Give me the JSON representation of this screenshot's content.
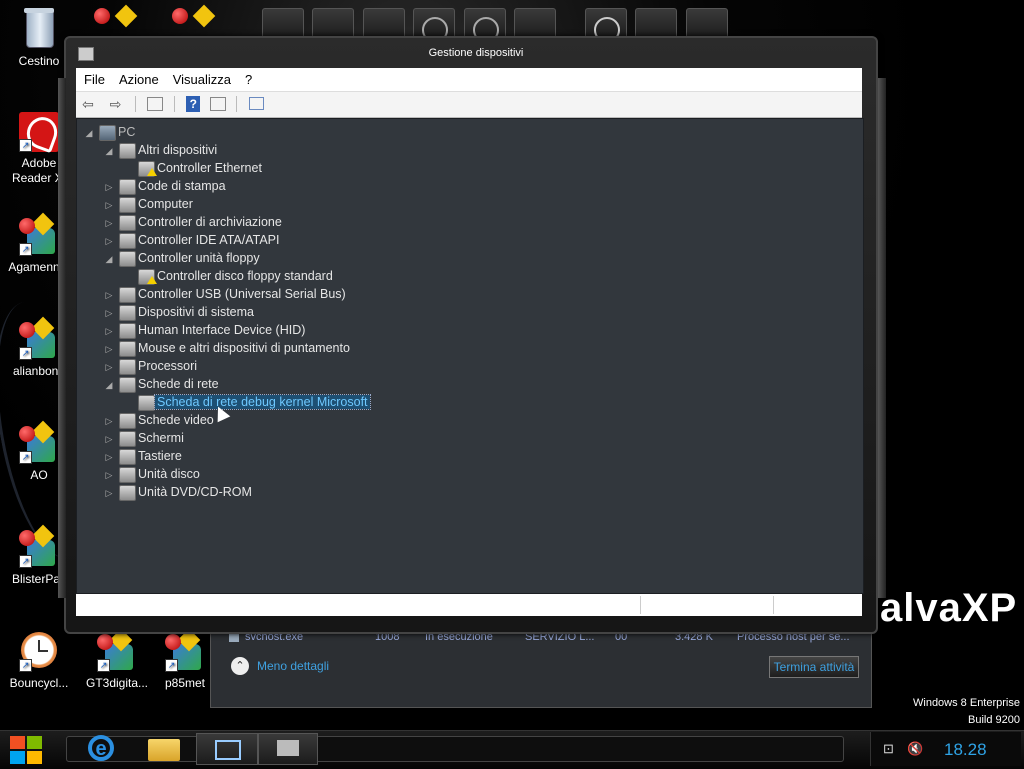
{
  "desktop": {
    "icons": [
      {
        "label": "Cestino"
      },
      {
        "label": "Adobe Reader XI"
      },
      {
        "label": "Agamenn..."
      },
      {
        "label": "alianbone"
      },
      {
        "label": "AO"
      },
      {
        "label": "BlisterPac"
      },
      {
        "label": "Bouncycl..."
      },
      {
        "label": "GT3digita..."
      },
      {
        "label": "p85met"
      }
    ],
    "brand_text": "alvaXP",
    "watermark_line1": "Windows 8 Enterprise",
    "watermark_line2": "Build 9200"
  },
  "window": {
    "title": "Gestione dispositivi",
    "menu": [
      "File",
      "Azione",
      "Visualizza",
      "?"
    ],
    "toolbar_icons": [
      "back-arrow-icon",
      "forward-arrow-icon",
      "show-hide-tree-icon",
      "help-icon",
      "properties-icon",
      "scan-hardware-icon"
    ],
    "tree": {
      "root": "PC",
      "items": [
        {
          "label": "Altri dispositivi",
          "level": 1,
          "expanded": true
        },
        {
          "label": "Controller Ethernet",
          "level": 2,
          "warning": true
        },
        {
          "label": "Code di stampa",
          "level": 1
        },
        {
          "label": "Computer",
          "level": 1
        },
        {
          "label": "Controller di archiviazione",
          "level": 1
        },
        {
          "label": "Controller IDE ATA/ATAPI",
          "level": 1
        },
        {
          "label": "Controller unità floppy",
          "level": 1,
          "expanded": true
        },
        {
          "label": "Controller disco floppy standard",
          "level": 2,
          "warning": true
        },
        {
          "label": "Controller USB (Universal Serial Bus)",
          "level": 1
        },
        {
          "label": "Dispositivi di sistema",
          "level": 1
        },
        {
          "label": "Human Interface Device (HID)",
          "level": 1
        },
        {
          "label": "Mouse e altri dispositivi di puntamento",
          "level": 1
        },
        {
          "label": "Processori",
          "level": 1
        },
        {
          "label": "Schede di rete",
          "level": 1,
          "expanded": true
        },
        {
          "label": "Scheda di rete debug kernel Microsoft",
          "level": 2,
          "selected": true
        },
        {
          "label": "Schede video",
          "level": 1
        },
        {
          "label": "Schermi",
          "level": 1
        },
        {
          "label": "Tastiere",
          "level": 1
        },
        {
          "label": "Unità disco",
          "level": 1
        },
        {
          "label": "Unità DVD/CD-ROM",
          "level": 1
        }
      ]
    }
  },
  "task_manager": {
    "row": {
      "name": "svchost.exe",
      "pid": "1008",
      "status": "In esecuzione",
      "user": "SERVIZIO L...",
      "cpu": "00",
      "memory": "3.428 K",
      "description": "Processo host per se..."
    },
    "less_details": "Meno dettagli",
    "end_task": "Termina attività"
  },
  "taskbar": {
    "clock": "18.28"
  },
  "colors": {
    "tree_bg": "#32373d",
    "accent": "#2fa3e6",
    "selection": "#1d4f73"
  }
}
